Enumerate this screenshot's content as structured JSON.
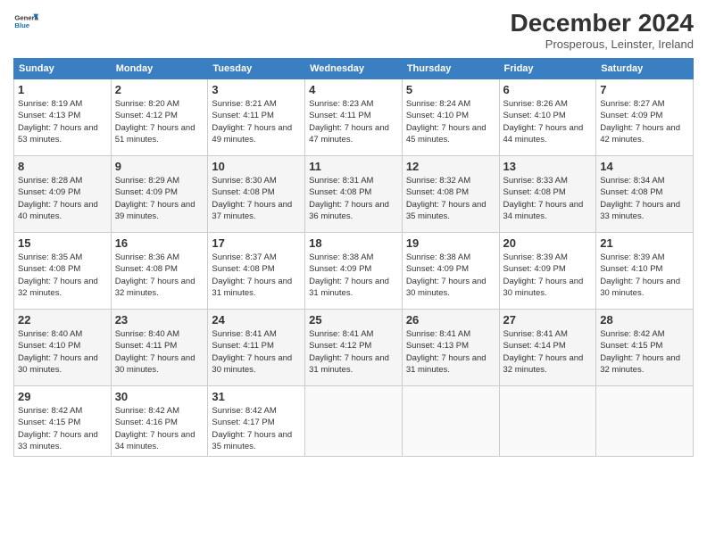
{
  "header": {
    "logo_general": "General",
    "logo_blue": "Blue",
    "month_title": "December 2024",
    "subtitle": "Prosperous, Leinster, Ireland"
  },
  "days_of_week": [
    "Sunday",
    "Monday",
    "Tuesday",
    "Wednesday",
    "Thursday",
    "Friday",
    "Saturday"
  ],
  "weeks": [
    [
      {
        "day": "1",
        "sunrise": "8:19 AM",
        "sunset": "4:13 PM",
        "daylight": "7 hours and 53 minutes."
      },
      {
        "day": "2",
        "sunrise": "8:20 AM",
        "sunset": "4:12 PM",
        "daylight": "7 hours and 51 minutes."
      },
      {
        "day": "3",
        "sunrise": "8:21 AM",
        "sunset": "4:11 PM",
        "daylight": "7 hours and 49 minutes."
      },
      {
        "day": "4",
        "sunrise": "8:23 AM",
        "sunset": "4:11 PM",
        "daylight": "7 hours and 47 minutes."
      },
      {
        "day": "5",
        "sunrise": "8:24 AM",
        "sunset": "4:10 PM",
        "daylight": "7 hours and 45 minutes."
      },
      {
        "day": "6",
        "sunrise": "8:26 AM",
        "sunset": "4:10 PM",
        "daylight": "7 hours and 44 minutes."
      },
      {
        "day": "7",
        "sunrise": "8:27 AM",
        "sunset": "4:09 PM",
        "daylight": "7 hours and 42 minutes."
      }
    ],
    [
      {
        "day": "8",
        "sunrise": "8:28 AM",
        "sunset": "4:09 PM",
        "daylight": "7 hours and 40 minutes."
      },
      {
        "day": "9",
        "sunrise": "8:29 AM",
        "sunset": "4:09 PM",
        "daylight": "7 hours and 39 minutes."
      },
      {
        "day": "10",
        "sunrise": "8:30 AM",
        "sunset": "4:08 PM",
        "daylight": "7 hours and 37 minutes."
      },
      {
        "day": "11",
        "sunrise": "8:31 AM",
        "sunset": "4:08 PM",
        "daylight": "7 hours and 36 minutes."
      },
      {
        "day": "12",
        "sunrise": "8:32 AM",
        "sunset": "4:08 PM",
        "daylight": "7 hours and 35 minutes."
      },
      {
        "day": "13",
        "sunrise": "8:33 AM",
        "sunset": "4:08 PM",
        "daylight": "7 hours and 34 minutes."
      },
      {
        "day": "14",
        "sunrise": "8:34 AM",
        "sunset": "4:08 PM",
        "daylight": "7 hours and 33 minutes."
      }
    ],
    [
      {
        "day": "15",
        "sunrise": "8:35 AM",
        "sunset": "4:08 PM",
        "daylight": "7 hours and 32 minutes."
      },
      {
        "day": "16",
        "sunrise": "8:36 AM",
        "sunset": "4:08 PM",
        "daylight": "7 hours and 32 minutes."
      },
      {
        "day": "17",
        "sunrise": "8:37 AM",
        "sunset": "4:08 PM",
        "daylight": "7 hours and 31 minutes."
      },
      {
        "day": "18",
        "sunrise": "8:38 AM",
        "sunset": "4:09 PM",
        "daylight": "7 hours and 31 minutes."
      },
      {
        "day": "19",
        "sunrise": "8:38 AM",
        "sunset": "4:09 PM",
        "daylight": "7 hours and 30 minutes."
      },
      {
        "day": "20",
        "sunrise": "8:39 AM",
        "sunset": "4:09 PM",
        "daylight": "7 hours and 30 minutes."
      },
      {
        "day": "21",
        "sunrise": "8:39 AM",
        "sunset": "4:10 PM",
        "daylight": "7 hours and 30 minutes."
      }
    ],
    [
      {
        "day": "22",
        "sunrise": "8:40 AM",
        "sunset": "4:10 PM",
        "daylight": "7 hours and 30 minutes."
      },
      {
        "day": "23",
        "sunrise": "8:40 AM",
        "sunset": "4:11 PM",
        "daylight": "7 hours and 30 minutes."
      },
      {
        "day": "24",
        "sunrise": "8:41 AM",
        "sunset": "4:11 PM",
        "daylight": "7 hours and 30 minutes."
      },
      {
        "day": "25",
        "sunrise": "8:41 AM",
        "sunset": "4:12 PM",
        "daylight": "7 hours and 31 minutes."
      },
      {
        "day": "26",
        "sunrise": "8:41 AM",
        "sunset": "4:13 PM",
        "daylight": "7 hours and 31 minutes."
      },
      {
        "day": "27",
        "sunrise": "8:41 AM",
        "sunset": "4:14 PM",
        "daylight": "7 hours and 32 minutes."
      },
      {
        "day": "28",
        "sunrise": "8:42 AM",
        "sunset": "4:15 PM",
        "daylight": "7 hours and 32 minutes."
      }
    ],
    [
      {
        "day": "29",
        "sunrise": "8:42 AM",
        "sunset": "4:15 PM",
        "daylight": "7 hours and 33 minutes."
      },
      {
        "day": "30",
        "sunrise": "8:42 AM",
        "sunset": "4:16 PM",
        "daylight": "7 hours and 34 minutes."
      },
      {
        "day": "31",
        "sunrise": "8:42 AM",
        "sunset": "4:17 PM",
        "daylight": "7 hours and 35 minutes."
      },
      null,
      null,
      null,
      null
    ]
  ],
  "labels": {
    "sunrise": "Sunrise:",
    "sunset": "Sunset:",
    "daylight": "Daylight:"
  }
}
